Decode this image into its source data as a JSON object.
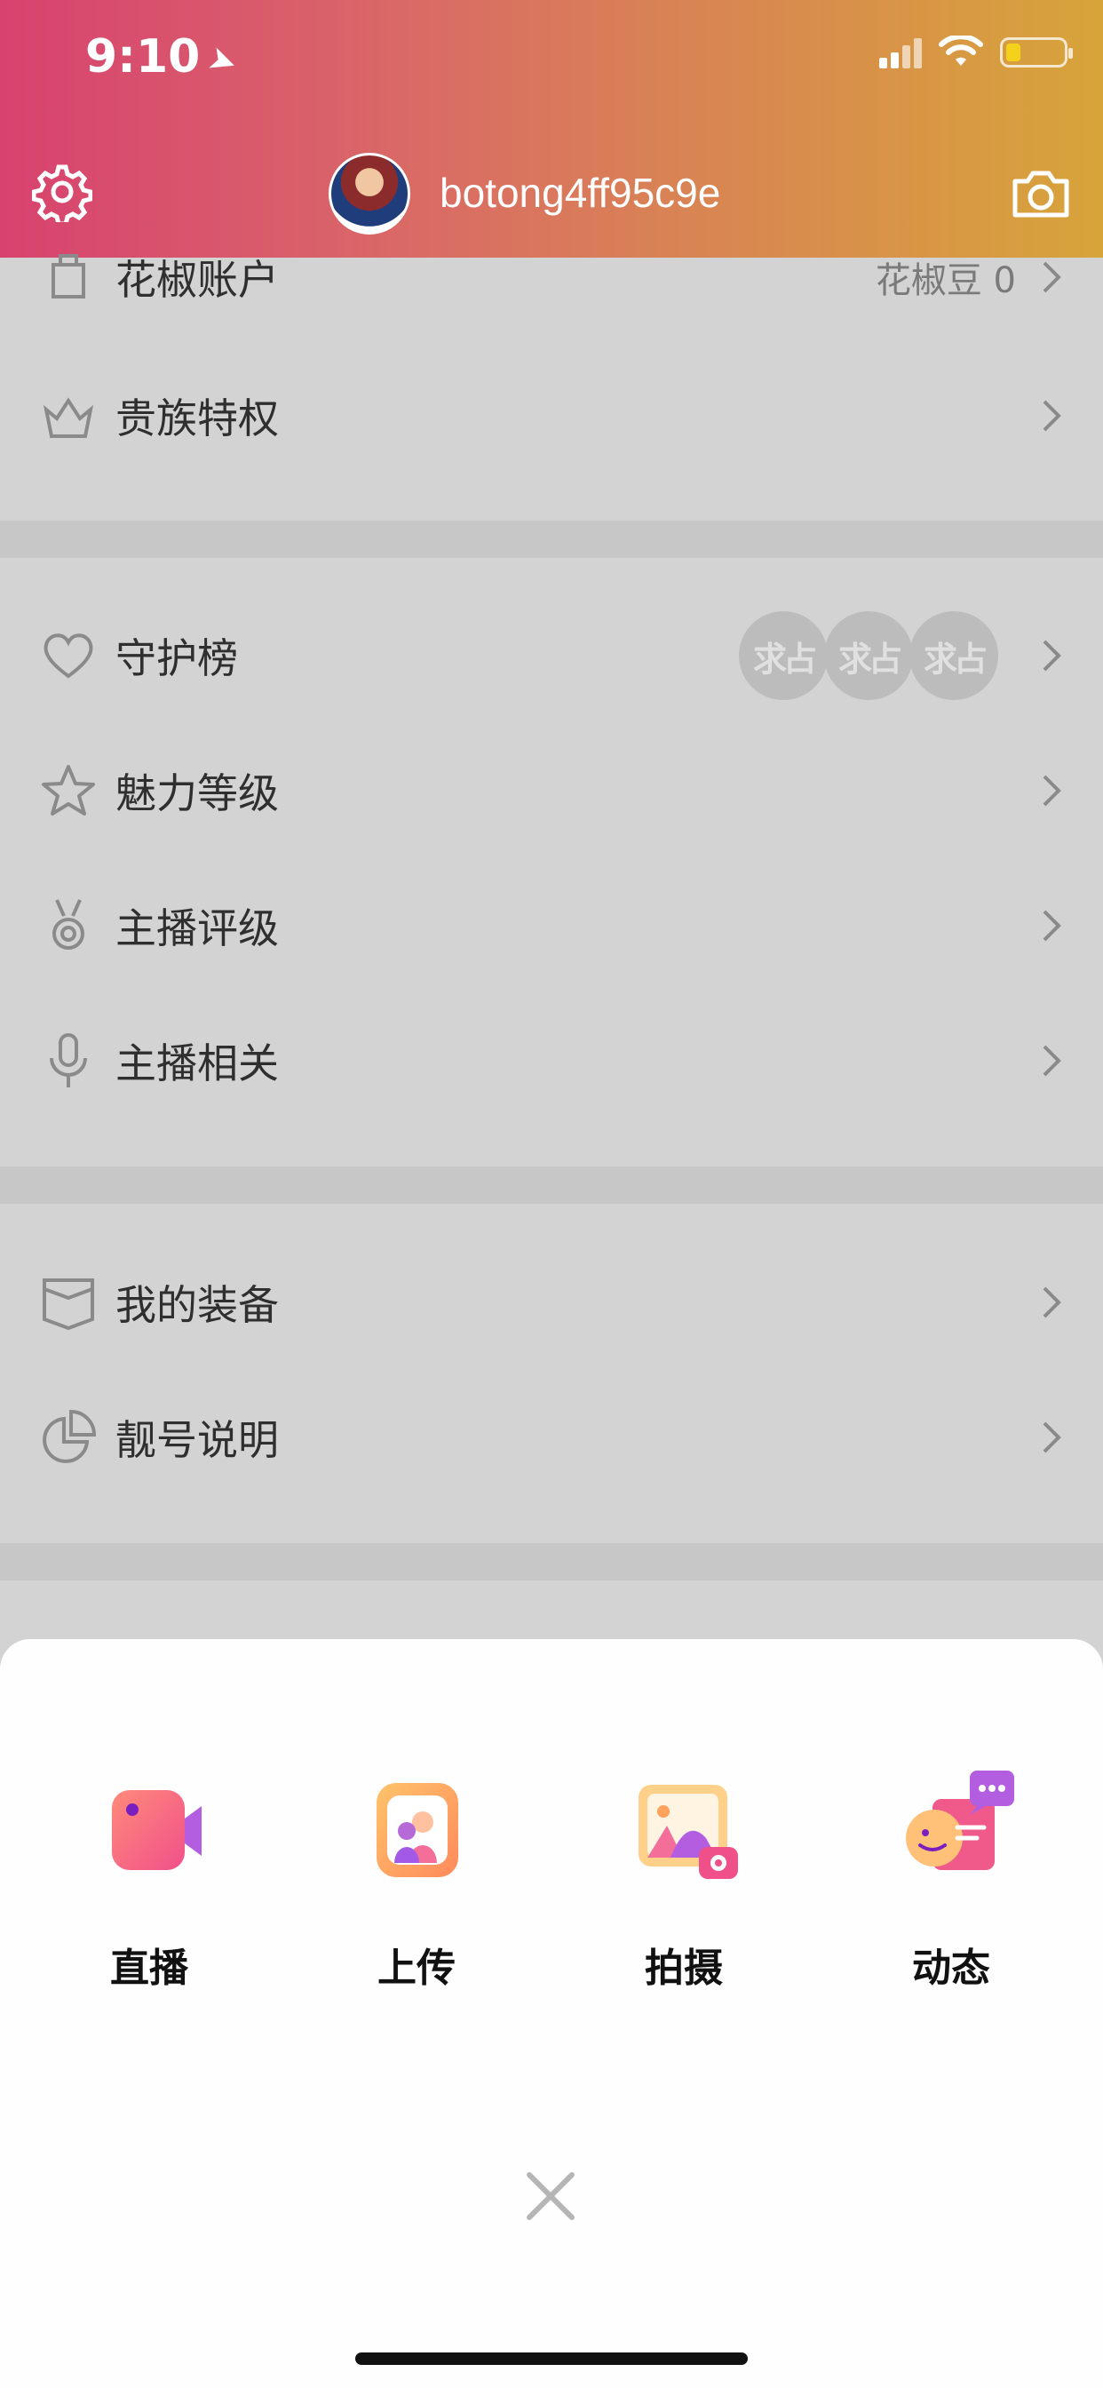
{
  "status_bar": {
    "time": "9:10"
  },
  "header": {
    "username": "botong4ff95c9e"
  },
  "menu": {
    "account": {
      "label": "花椒账户",
      "value": "花椒豆 0"
    },
    "noble": {
      "label": "贵族特权"
    },
    "guard": {
      "label": "守护榜",
      "badges": [
        "求占",
        "求占",
        "求占"
      ]
    },
    "charm": {
      "label": "魅力等级"
    },
    "anchor_rating": {
      "label": "主播评级"
    },
    "anchor_related": {
      "label": "主播相关"
    },
    "equipment": {
      "label": "我的装备"
    },
    "pretty_number": {
      "label": "靓号说明"
    }
  },
  "sheet": {
    "actions": [
      {
        "label": "直播",
        "icon": "video-camera-icon"
      },
      {
        "label": "上传",
        "icon": "upload-photo-icon"
      },
      {
        "label": "拍摄",
        "icon": "picture-camera-icon"
      },
      {
        "label": "动态",
        "icon": "moment-chat-icon"
      }
    ]
  },
  "colors": {
    "header_start": "#d8426f",
    "header_end": "#d7a43a",
    "accent_pink": "#f05a8a",
    "accent_purple": "#a259e6"
  }
}
